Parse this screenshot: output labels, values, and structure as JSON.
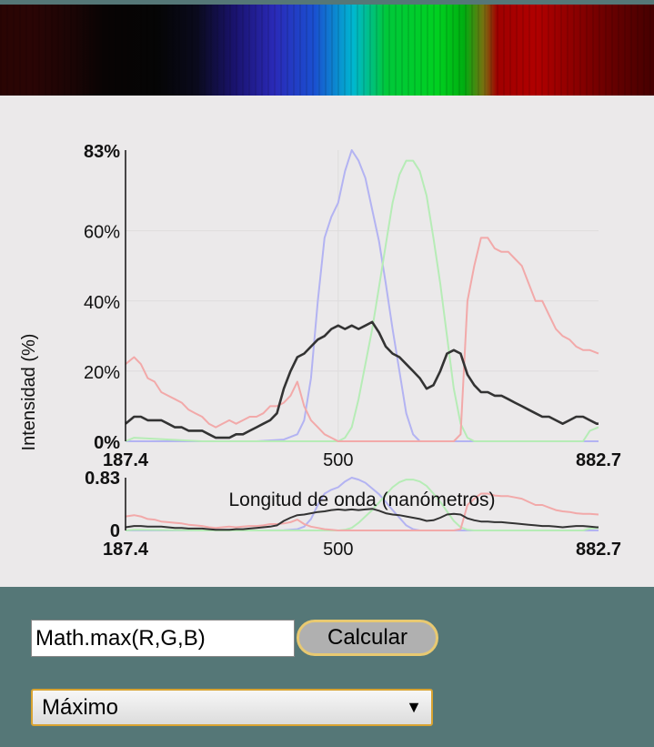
{
  "chart_data": {
    "type": "line",
    "ylabel": "Intensidad (%)",
    "xlabel": "Longitud de onda (nanómetros)",
    "main": {
      "xlim": [
        187.4,
        882.7
      ],
      "ylim": [
        0,
        83
      ],
      "x_ticks": [
        "187.4",
        "500",
        "882.7"
      ],
      "y_ticks": [
        "83%",
        "60%",
        "40%",
        "20%",
        "0%"
      ],
      "y_tick_values": [
        83,
        60,
        40,
        20,
        0
      ],
      "x_tick_values": [
        187.4,
        500,
        882.7
      ]
    },
    "overview": {
      "x_ticks": [
        "187.4",
        "500",
        "882.7"
      ],
      "y_ticks": [
        "0.83",
        "0"
      ],
      "y_tick_values": [
        0.83,
        0
      ]
    },
    "colors": {
      "red": "#f2a9a9",
      "green": "#b6ecb6",
      "blue": "#b3b3f2",
      "max": "#333333"
    },
    "series": [
      {
        "color": "blue",
        "x": [
          187.4,
          380,
          420,
          440,
          450,
          460,
          470,
          480,
          490,
          500,
          510,
          520,
          530,
          540,
          550,
          560,
          570,
          580,
          590,
          600,
          610,
          620,
          630,
          640,
          650,
          660,
          882.7
        ],
        "y": [
          0,
          0,
          0.5,
          2,
          6,
          18,
          40,
          58,
          64,
          68,
          77,
          83,
          80,
          75,
          66,
          57,
          45,
          32,
          20,
          8,
          2,
          0,
          0,
          0,
          0,
          0,
          0
        ]
      },
      {
        "color": "green",
        "x": [
          187.4,
          200,
          300,
          400,
          480,
          500,
          510,
          520,
          530,
          540,
          550,
          560,
          570,
          580,
          590,
          600,
          610,
          620,
          630,
          640,
          650,
          660,
          670,
          680,
          690,
          700,
          710,
          720,
          860,
          870,
          882.7
        ],
        "y": [
          0,
          1,
          0,
          0,
          0,
          0,
          1,
          4,
          12,
          22,
          32,
          44,
          56,
          68,
          76,
          80,
          80,
          77,
          70,
          58,
          45,
          30,
          15,
          5,
          1,
          0,
          0,
          0,
          0,
          3,
          4
        ]
      },
      {
        "color": "red",
        "x": [
          187.4,
          200,
          210,
          220,
          230,
          240,
          250,
          260,
          270,
          280,
          290,
          300,
          310,
          320,
          330,
          340,
          350,
          360,
          370,
          380,
          390,
          400,
          410,
          420,
          430,
          440,
          450,
          460,
          470,
          480,
          490,
          500,
          510,
          520,
          530,
          540,
          550,
          560,
          570,
          580,
          590,
          600,
          610,
          620,
          630,
          640,
          650,
          660,
          670,
          680,
          690,
          700,
          710,
          720,
          730,
          740,
          750,
          760,
          770,
          780,
          790,
          800,
          810,
          820,
          830,
          840,
          850,
          860,
          870,
          882.7
        ],
        "y": [
          22,
          24,
          22,
          18,
          17,
          14,
          13,
          12,
          11,
          9,
          8,
          7,
          5,
          4,
          5,
          6,
          5,
          6,
          7,
          7,
          8,
          10,
          10,
          11,
          13,
          17,
          10,
          6,
          4,
          2,
          1,
          0,
          0,
          0,
          0,
          0,
          0,
          0,
          0,
          0,
          0,
          0,
          0,
          0,
          0,
          0,
          0,
          0,
          0,
          2,
          40,
          50,
          58,
          58,
          55,
          54,
          54,
          52,
          50,
          45,
          40,
          40,
          36,
          32,
          30,
          29,
          27,
          26,
          26,
          25
        ]
      },
      {
        "color": "max",
        "x": [
          187.4,
          200,
          210,
          220,
          230,
          240,
          250,
          260,
          270,
          280,
          290,
          300,
          310,
          320,
          330,
          340,
          350,
          360,
          370,
          380,
          390,
          400,
          410,
          420,
          430,
          440,
          450,
          460,
          470,
          480,
          490,
          500,
          510,
          520,
          530,
          540,
          550,
          560,
          570,
          580,
          590,
          600,
          610,
          620,
          630,
          640,
          650,
          660,
          670,
          680,
          690,
          700,
          710,
          720,
          730,
          740,
          750,
          760,
          770,
          780,
          790,
          800,
          810,
          820,
          830,
          840,
          850,
          860,
          870,
          880,
          882.7
        ],
        "y": [
          5,
          7,
          7,
          6,
          6,
          6,
          5,
          4,
          4,
          3,
          3,
          3,
          2,
          1,
          1,
          1,
          2,
          2,
          3,
          4,
          5,
          6,
          8,
          15,
          20,
          24,
          25,
          27,
          29,
          30,
          32,
          33,
          32,
          33,
          32,
          33,
          34,
          31,
          27,
          25,
          24,
          22,
          20,
          18,
          15,
          16,
          20,
          25,
          26,
          25,
          19,
          16,
          14,
          14,
          13,
          13,
          12,
          11,
          10,
          9,
          8,
          7,
          7,
          6,
          5,
          6,
          7,
          7,
          6,
          5,
          5
        ]
      }
    ]
  },
  "controls": {
    "formula_value": "Math.max(R,G,B)",
    "calc_label": "Calcular",
    "mode_value": "Máximo",
    "mode_arrow": "▼"
  }
}
